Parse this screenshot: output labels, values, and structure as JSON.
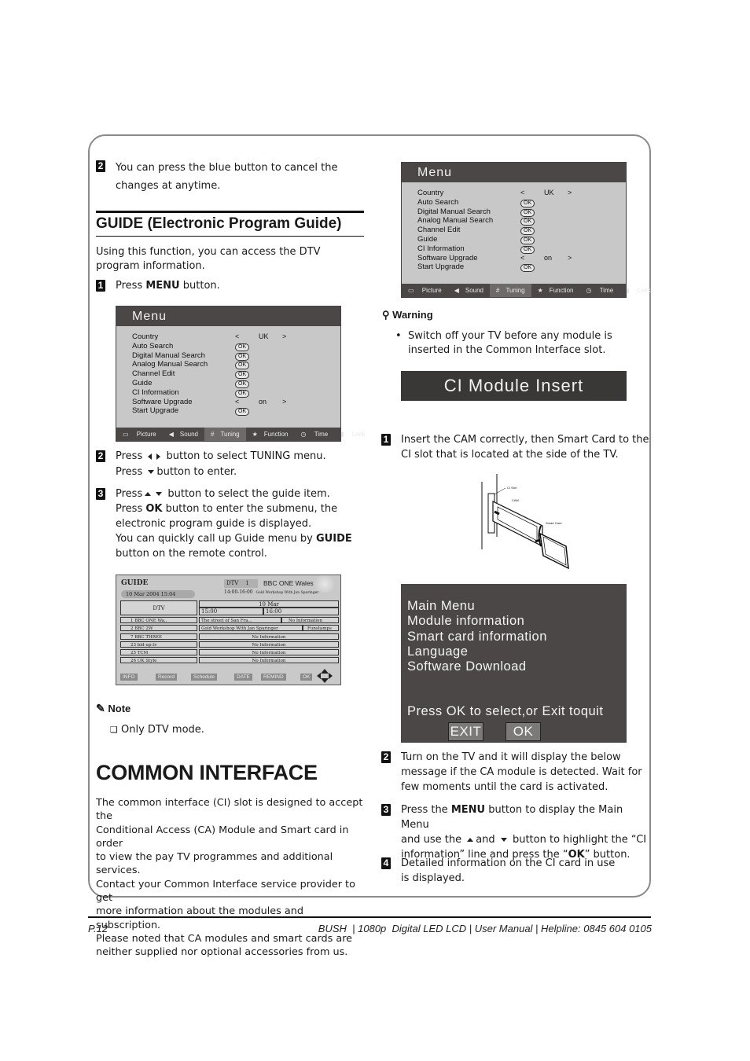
{
  "left": {
    "step2_top": {
      "num": "2",
      "text": "You can press the blue button to cancel the changes at anytime."
    },
    "guide_heading": "GUIDE (Electronic Program Guide)",
    "guide_intro": "Using this function, you can access the DTV program information.",
    "step1": {
      "num": "1",
      "pre": "Press ",
      "bold": "MENU",
      "post": " button."
    },
    "step2": {
      "num": "2",
      "line1_pre": "Press",
      "line1_post": "button to select TUNING menu.",
      "line2_pre": "Press",
      "line2_post": "button to enter."
    },
    "step3": {
      "num": "3",
      "line1_pre": "Press",
      "line1_post": "button to select the guide item.",
      "line2_pre": "Press ",
      "line2_bold": "OK",
      "line2_post": " button to enter the submenu, the",
      "line3": "electronic program guide is displayed.",
      "line4_pre": "You can quickly call up Guide menu by ",
      "line4_bold": "GUIDE",
      "line5": "button on the remote control."
    },
    "note_label": "Note",
    "note_item": "Only DTV mode.",
    "ci_heading": "COMMON INTERFACE",
    "ci_paragraph": [
      "The common interface (CI) slot is designed to accept the",
      "Conditional Access (CA) Module and Smart card in order",
      "to view the pay TV programmes and additional services.",
      "Contact your Common Interface service provider to get",
      "more information about the modules and subscription.",
      "Please noted that CA modules and smart cards are",
      "neither supplied nor optional accessories from us."
    ]
  },
  "tv_menu": {
    "title": "Menu",
    "items": [
      "Country",
      "Auto Search",
      "Digital Manual Search",
      "Analog Manual Search",
      "Channel Edit",
      "Guide",
      "CI Information",
      "Software Upgrade",
      "Start Upgrade"
    ],
    "country_value": "UK",
    "software_upgrade_value": "on",
    "ok_label": "OK",
    "arrow_left": "<",
    "arrow_right": ">",
    "tabs": [
      "Picture",
      "Sound",
      "Tuning",
      "Function",
      "Time",
      "Lock"
    ],
    "active_tab": "Tuning"
  },
  "guide_screen": {
    "title": "GUIDE",
    "datetime": "10 Mar 2004 15:04",
    "source_label": "DTV",
    "channel_number": "1",
    "channel_name": "BBC ONE Wales",
    "current_time_range": "14:00-16:00",
    "current_program": "Gold Workshop With Jan Sparinger",
    "column_header": "DTV",
    "date_header": "10 Mar",
    "times": [
      "15:00",
      "16:00"
    ],
    "channels": [
      "1 BBC ONE Wa..",
      "2 BBC 2W",
      "7 BBC THREE",
      "23 bid-up.tv",
      "25 TCM",
      "26 UK Style"
    ],
    "programs": [
      [
        "The street of San Fra...",
        "No Information"
      ],
      [
        "Gold Workshop With Jan Sparinger",
        "Funstamps"
      ],
      [
        "No Information"
      ],
      [
        "No Information"
      ],
      [
        "No Information"
      ],
      [
        "No Information"
      ]
    ],
    "buttons": [
      "INFO",
      "Record",
      "Schedule",
      "DATE",
      "REMIND",
      "OK"
    ]
  },
  "right": {
    "warning_label": "Warning",
    "warning_item": "Switch off your TV before any module is inserted in the Common Interface slot.",
    "ci_insert_banner": "CI Module Insert",
    "step1": {
      "num": "1",
      "text": "Insert the CAM correctly, then Smart Card to the CI slot that is located at the side of the TV."
    },
    "diagram_labels": {
      "slot": "CI Slot",
      "cam": "CAM",
      "card": "Smart Card"
    },
    "ci_main_menu": {
      "items": [
        "Main Menu",
        "Module information",
        "Smart card information",
        "Language",
        "Software Download"
      ],
      "prompt": "Press OK to select,or Exit toquit",
      "exit_label": "EXIT",
      "ok_label": "OK"
    },
    "step2": {
      "num": "2",
      "text": "Turn on the TV and it will display the below message if the CA module is detected. Wait for few moments until the card is activated."
    },
    "step3": {
      "num": "3",
      "pre": "Press the ",
      "bold1": "MENU",
      "mid1": " button to display the Main Menu",
      "line2_pre": "and use the",
      "line2_and": "and",
      "line2_post": "button to highlight the “CI",
      "line3_pre": "information” line and press the “",
      "bold2": "OK",
      "line3_post": "” button."
    },
    "step4": {
      "num": "4",
      "text": "Detailed information on the CI card in use is displayed."
    }
  },
  "footer": {
    "page": "P.12",
    "brand_line": "BUSH  | 1080p  Digital LED LCD | User Manual | Helpline: 0845 604 0105"
  }
}
